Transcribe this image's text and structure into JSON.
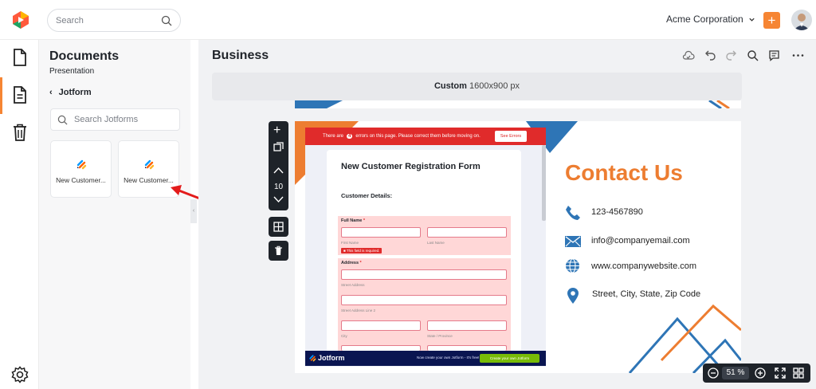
{
  "header": {
    "search_placeholder": "Search",
    "org_name": "Acme Corporation"
  },
  "panel": {
    "title": "Documents",
    "subtitle": "Presentation",
    "back_label": "Jotform",
    "search_placeholder": "Search Jotforms",
    "cards": [
      {
        "label": "New Customer..."
      },
      {
        "label": "New Customer..."
      }
    ]
  },
  "canvas": {
    "title": "Business",
    "size_prefix": "Custom",
    "size_value": "1600x900 px",
    "page_count": "10",
    "zoom_value": "51",
    "zoom_unit": "%"
  },
  "form": {
    "error_text_1": "There are",
    "error_count": "4",
    "error_text_2": "errors on this page. Please correct them before moving on.",
    "see_errors": "See Errors",
    "title": "New Customer Registration Form",
    "section": "Customer Details:",
    "full_name": "Full Name",
    "required_mark": "*",
    "first_name": "First Name",
    "last_name": "Last Name",
    "required_msg": "This field is required.",
    "address": "Address",
    "street": "Street Address",
    "street2": "Street Address Line 2",
    "city": "City",
    "state": "State / Province",
    "footer_brand": "Jotform",
    "footer_text": "Now create your own Jotform - It's free!",
    "footer_button": "Create your own Jotform"
  },
  "contact": {
    "title": "Contact Us",
    "phone": "123-4567890",
    "email": "info@companyemail.com",
    "website": "www.companywebsite.com",
    "address": "Street, City, State, Zip Code"
  },
  "colors": {
    "accent": "#f68533",
    "contact_orange": "#ed7d31",
    "contact_blue": "#2e75b6",
    "error_red": "#e02b2b",
    "jotform_navy": "#0a1551"
  }
}
